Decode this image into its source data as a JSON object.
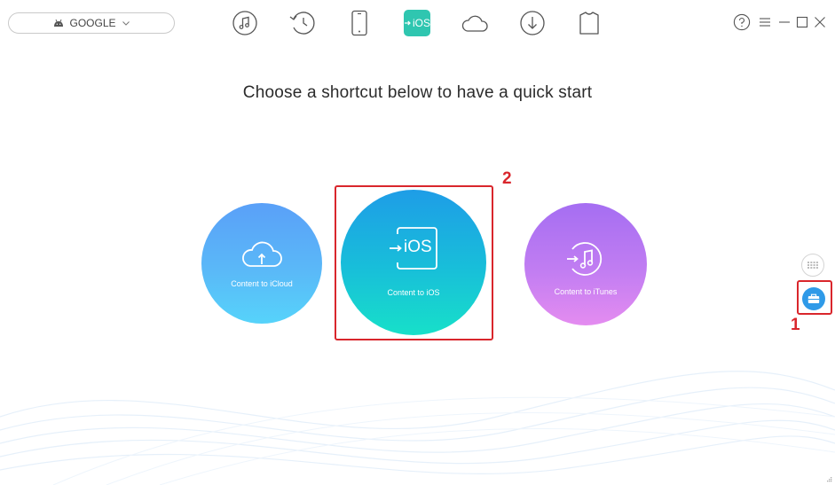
{
  "device": {
    "name": "GOOGLE"
  },
  "nav": {
    "ios_label": "iOS"
  },
  "main": {
    "headline": "Choose a shortcut below to have a quick start",
    "shortcuts": [
      {
        "label": "Content to iCloud",
        "color": "#5ab3f8"
      },
      {
        "label": "Content to iOS",
        "color": "#1bc1d8"
      },
      {
        "label": "Content to iTunes",
        "color": "#c57ff2"
      }
    ],
    "ios_icon_text": "iOS"
  },
  "annotations": {
    "marker_toolbox": "1",
    "marker_ios": "2",
    "color": "#d9262c"
  },
  "colors": {
    "accent": "#2f9ae8",
    "ios_active": "#2fc6b0"
  }
}
